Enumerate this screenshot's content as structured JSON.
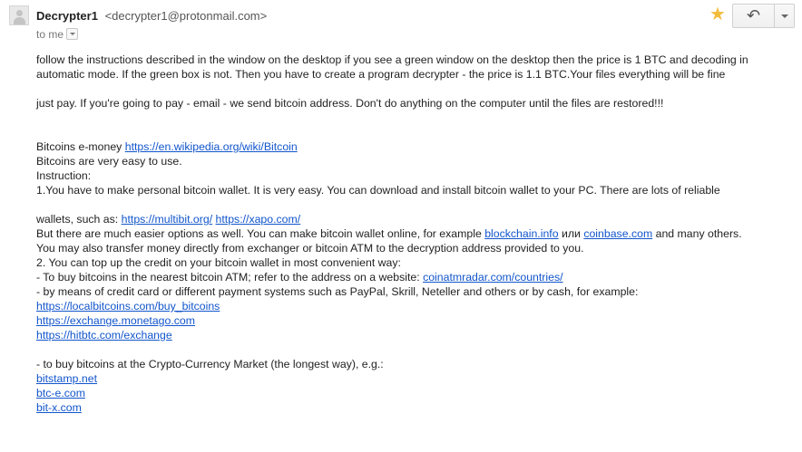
{
  "sender": {
    "name": "Decrypter1",
    "address": "<decrypter1@protonmail.com>"
  },
  "recipient": "to me",
  "actions": {
    "reply_icon": "reply-arrow-icon",
    "star_icon": "star-icon"
  },
  "colors": {
    "link": "#1155cc",
    "star": "#f2bc3c",
    "text": "#222222"
  },
  "body": {
    "l1a": "follow the instructions described in the window on the desktop if you see a green window on the desktop then the price is 1 BTC and decoding in",
    "l1b": "automatic mode. If the green box is not. Then you have to create a program decrypter - the price is 1.1 BTC.Your files everything will be fine",
    "l2": "just pay. If you're going to pay - email - we send bitcoin address. Don't do anything on the computer until the files are restored!!!",
    "emoney_prefix": "Bitcoins e-money ",
    "emoney_link": "https://en.wikipedia.org/wiki/Bitcoin",
    "easy": "Bitcoins are very easy to use.",
    "instruction": "Instruction:",
    "step1": "1.You have to make personal bitcoin wallet. It is very easy. You can download and install bitcoin wallet to your PC. There are lots of reliable",
    "wallets_prefix": "wallets, such as: ",
    "wallet_link1": "https://multibit.org/",
    "wallet_link2": "https://xapo.com/",
    "easier_prefix": "But there are much easier options as well. You can make bitcoin wallet online, for example ",
    "blockchain_link": "blockchain.info",
    "ili": " или ",
    "coinbase_link": "coinbase.com",
    "easier_suffix": " and many others.",
    "transfer": "You may also transfer money directly from exchanger or bitcoin ATM to the decryption address provided to you.",
    "step2": "2. You can top up the credit on your bitcoin wallet in most convenient way:",
    "atm_prefix": "- To buy bitcoins in the nearest bitcoin ATM; refer to the address on a website: ",
    "atm_link": "coinatmradar.com/countries/",
    "card": "- by means of credit card or different payment systems such as PayPal, Skrill, Neteller and others or by cash, for example:",
    "link_localbitcoins": "https://localbitcoins.com/buy_bitcoins",
    "link_monetago": "https://exchange.monetago.com",
    "link_hitbtc": "https://hitbtc.com/exchange",
    "market": "- to buy bitcoins at the Crypto-Currency Market (the longest way), e.g.:",
    "link_bitstamp": "bitstamp.net",
    "link_btce": "btc-e.com",
    "link_bitx": "bit-x.com"
  }
}
